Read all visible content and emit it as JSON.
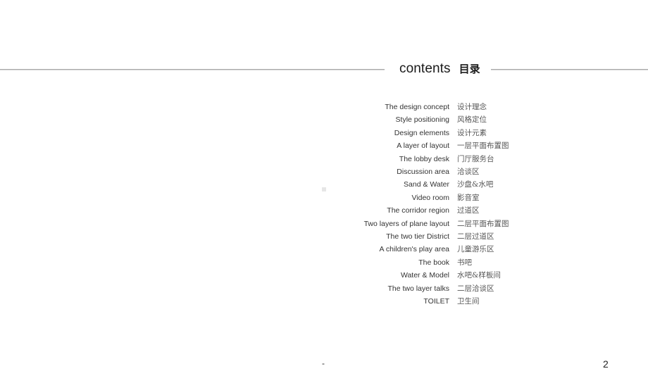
{
  "heading": {
    "title_en": "contents",
    "title_zh": "目录"
  },
  "toc": [
    {
      "en": "The design concept",
      "zh": "设计理念"
    },
    {
      "en": "Style positioning",
      "zh": "风格定位"
    },
    {
      "en": "Design elements",
      "zh": "设计元素"
    },
    {
      "en": "A layer of layout",
      "zh": "一层平面布置图"
    },
    {
      "en": "The lobby desk",
      "zh": "门厅服务台"
    },
    {
      "en": "Discussion area",
      "zh": "洽谈区"
    },
    {
      "en": "Sand & Water",
      "zh": "沙盘&水吧"
    },
    {
      "en": "Video room",
      "zh": "影音室"
    },
    {
      "en": "The corridor region",
      "zh": "过道区"
    },
    {
      "en": "Two layers of plane layout",
      "zh": "二层平面布置图"
    },
    {
      "en": "The two tier District",
      "zh": "二层过道区"
    },
    {
      "en": "A children's play area",
      "zh": "儿童游乐区"
    },
    {
      "en": "The book",
      "zh": "书吧"
    },
    {
      "en": "Water & Model",
      "zh": "水吧&样板间"
    },
    {
      "en": "The two layer talks",
      "zh": "二层洽谈区"
    },
    {
      "en": "TOILET",
      "zh": "卫生间"
    }
  ],
  "footer": {
    "dash": "-",
    "page_number": "2"
  }
}
